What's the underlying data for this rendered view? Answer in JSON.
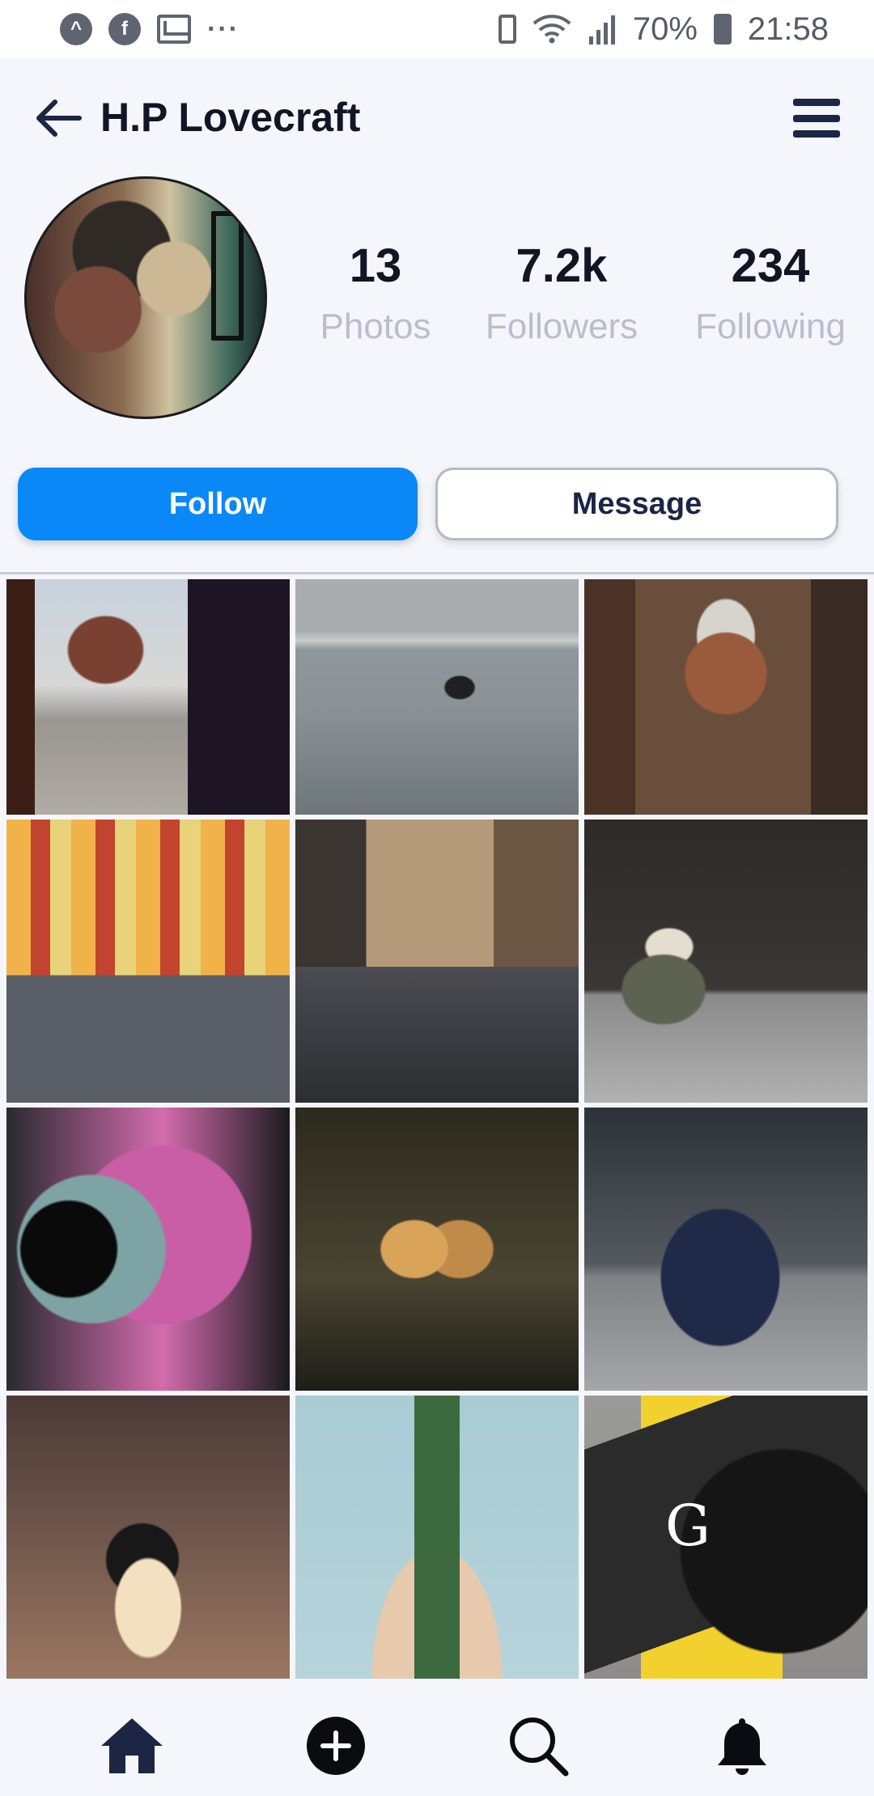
{
  "status_bar": {
    "battery_percent": "70%",
    "time": "21:58",
    "left_icons": [
      "assistant-icon",
      "facebook-icon",
      "gmail-icon",
      "more-dots-icon"
    ],
    "right_icons": [
      "battery-saver-icon",
      "wifi-icon",
      "signal-icon",
      "battery-icon"
    ]
  },
  "header": {
    "title": "H.P Lovecraft"
  },
  "profile": {
    "stats": [
      {
        "value": "13",
        "label": "Photos"
      },
      {
        "value": "7.2k",
        "label": "Followers"
      },
      {
        "value": "234",
        "label": "Following"
      }
    ]
  },
  "actions": {
    "follow_label": "Follow",
    "message_label": "Message"
  },
  "colors": {
    "accent": "#0a88f8",
    "title": "#111524",
    "muted": "#b9bdcc",
    "nav": "#1d2545"
  },
  "photos": [
    {
      "subject": "temple-gate"
    },
    {
      "subject": "boat-lake"
    },
    {
      "subject": "train-street"
    },
    {
      "subject": "street-traffic"
    },
    {
      "subject": "alley-street"
    },
    {
      "subject": "bicycle-vendor"
    },
    {
      "subject": "camera-lens"
    },
    {
      "subject": "lamp-figures"
    },
    {
      "subject": "motorcycle"
    },
    {
      "subject": "camera"
    },
    {
      "subject": "cactus"
    },
    {
      "subject": "graphic-design-book"
    }
  ],
  "book_cover_text": "G",
  "nav": {
    "items": [
      "home-icon",
      "add-icon",
      "search-icon",
      "bell-icon"
    ]
  }
}
